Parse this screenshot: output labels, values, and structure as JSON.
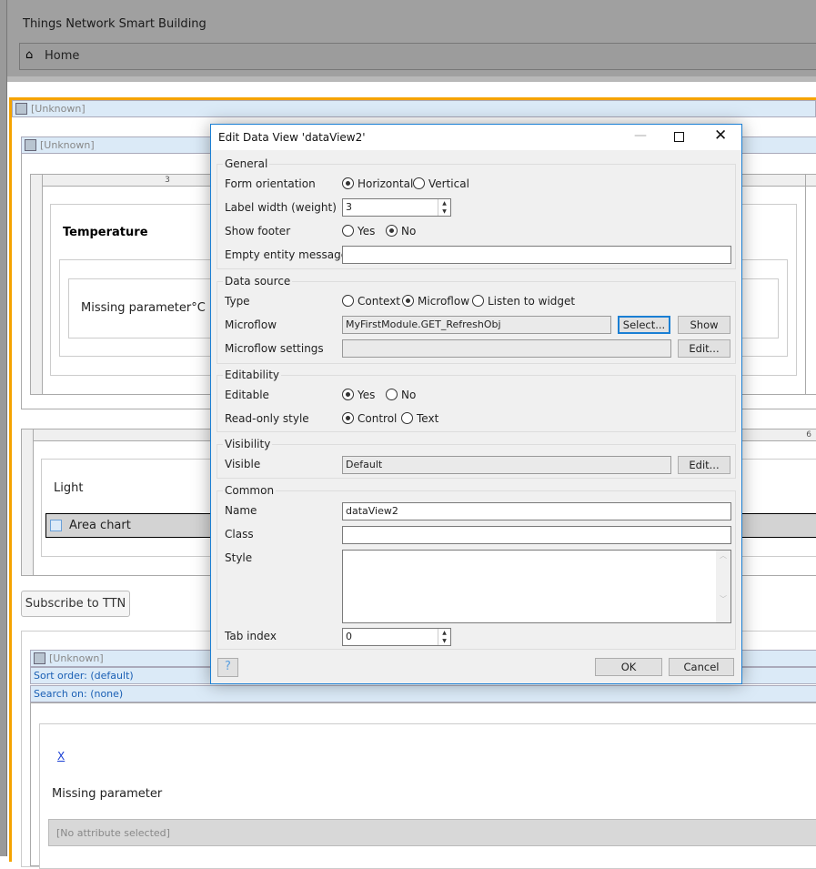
{
  "app": {
    "title": "Things Network Smart Building",
    "home": "Home"
  },
  "canvas": {
    "unknown": "[Unknown]",
    "grid1_col": "3",
    "temperature": "Temperature",
    "missing_c": "Missing parameter°C",
    "grid2_col": "6",
    "light": "Light",
    "area_chart": "Area chart",
    "subscribe": "Subscribe to TTN",
    "sort_order": "Sort order: (default)",
    "search_on": "Search on: (none)",
    "x_link": "X",
    "missing": "Missing parameter",
    "no_attr": "[No attribute selected]"
  },
  "dialog": {
    "title": "Edit Data View 'dataView2'",
    "general": {
      "label": "General",
      "form_orientation": "Form orientation",
      "horizontal": "Horizontal",
      "vertical": "Vertical",
      "orientation_selected": "Horizontal",
      "label_width": "Label width (weight)",
      "label_width_value": "3",
      "show_footer": "Show footer",
      "yes": "Yes",
      "no": "No",
      "footer_selected": "No",
      "empty_msg": "Empty entity message",
      "empty_msg_value": ""
    },
    "data_source": {
      "label": "Data source",
      "type": "Type",
      "context": "Context",
      "microflow_opt": "Microflow",
      "listen": "Listen to widget",
      "type_selected": "Microflow",
      "microflow": "Microflow",
      "microflow_value": "MyFirstModule.GET_RefreshObj",
      "select": "Select...",
      "show": "Show",
      "settings": "Microflow settings",
      "settings_value": "",
      "edit": "Edit..."
    },
    "editability": {
      "label": "Editability",
      "editable": "Editable",
      "yes": "Yes",
      "no": "No",
      "editable_selected": "Yes",
      "readonly": "Read-only style",
      "control": "Control",
      "text": "Text",
      "readonly_selected": "Control"
    },
    "visibility": {
      "label": "Visibility",
      "visible": "Visible",
      "visible_value": "Default",
      "edit": "Edit..."
    },
    "common": {
      "label": "Common",
      "name": "Name",
      "name_value": "dataView2",
      "class": "Class",
      "class_value": "",
      "style": "Style",
      "style_value": "",
      "tab_index": "Tab index",
      "tab_index_value": "0"
    },
    "ok": "OK",
    "cancel": "Cancel"
  }
}
